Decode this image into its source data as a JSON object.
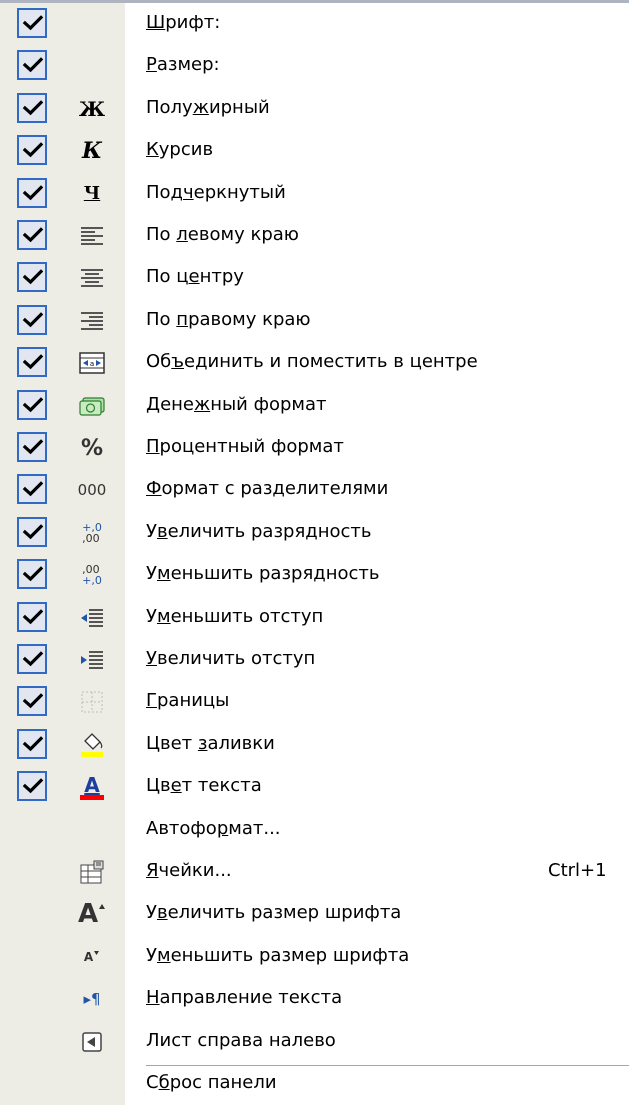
{
  "menu": {
    "items": [
      {
        "name": "font",
        "pre": "",
        "key": "Ш",
        "post": "рифт:",
        "checked": true,
        "icon": ""
      },
      {
        "name": "size",
        "pre": "",
        "key": "Р",
        "post": "азмер:",
        "checked": true,
        "icon": ""
      },
      {
        "name": "bold",
        "pre": "Полу",
        "key": "ж",
        "post": "ирный",
        "checked": true,
        "icon": "bold-icon"
      },
      {
        "name": "italic",
        "pre": "",
        "key": "К",
        "post": "урсив",
        "checked": true,
        "icon": "italic-icon"
      },
      {
        "name": "underline",
        "pre": "Под",
        "key": "ч",
        "post": "еркнутый",
        "checked": true,
        "icon": "underline-icon"
      },
      {
        "name": "align-left",
        "pre": "По ",
        "key": "л",
        "post": "евому краю",
        "checked": true,
        "icon": "align-left-icon"
      },
      {
        "name": "align-center",
        "pre": "По ц",
        "key": "е",
        "post": "нтру",
        "checked": true,
        "icon": "align-center-icon"
      },
      {
        "name": "align-right",
        "pre": "По ",
        "key": "п",
        "post": "равому краю",
        "checked": true,
        "icon": "align-right-icon"
      },
      {
        "name": "merge-center",
        "pre": "Об",
        "key": "ъ",
        "post": "единить и поместить в центре",
        "checked": true,
        "icon": "merge-center-icon"
      },
      {
        "name": "currency",
        "pre": "Дене",
        "key": "ж",
        "post": "ный формат",
        "checked": true,
        "icon": "currency-icon"
      },
      {
        "name": "percent",
        "pre": "",
        "key": "П",
        "post": "роцентный формат",
        "checked": true,
        "icon": "percent-icon"
      },
      {
        "name": "comma-style",
        "pre": "",
        "key": "Ф",
        "post": "ормат с разделителями",
        "checked": true,
        "icon": "comma-style-icon"
      },
      {
        "name": "increase-decimal",
        "pre": "У",
        "key": "в",
        "post": "еличить разрядность",
        "checked": true,
        "icon": "increase-decimal-icon"
      },
      {
        "name": "decrease-decimal",
        "pre": "У",
        "key": "м",
        "post": "еньшить разрядность",
        "checked": true,
        "icon": "decrease-decimal-icon"
      },
      {
        "name": "decrease-indent",
        "pre": "У",
        "key": "м",
        "post": "еньшить отступ",
        "checked": true,
        "icon": "decrease-indent-icon"
      },
      {
        "name": "increase-indent",
        "pre": "",
        "key": "У",
        "post": "величить отступ",
        "checked": true,
        "icon": "increase-indent-icon"
      },
      {
        "name": "borders",
        "pre": "",
        "key": "Г",
        "post": "раницы",
        "checked": true,
        "icon": "borders-icon"
      },
      {
        "name": "fill-color",
        "pre": "Цвет ",
        "key": "з",
        "post": "аливки",
        "checked": true,
        "icon": "fill-color-icon"
      },
      {
        "name": "font-color",
        "pre": "Цв",
        "key": "е",
        "post": "т текста",
        "checked": true,
        "icon": "font-color-icon"
      },
      {
        "name": "autoformat",
        "pre": "Автофо",
        "key": "р",
        "post": "мат...",
        "checked": false,
        "icon": ""
      },
      {
        "name": "format-cells",
        "pre": "",
        "key": "Я",
        "post": "чейки...",
        "checked": false,
        "icon": "format-cells-icon",
        "shortcut": "Ctrl+1"
      },
      {
        "name": "grow-font",
        "pre": "У",
        "key": "в",
        "post": "еличить размер шрифта",
        "checked": false,
        "icon": "grow-font-icon"
      },
      {
        "name": "shrink-font",
        "pre": "У",
        "key": "м",
        "post": "еньшить размер шрифта",
        "checked": false,
        "icon": "shrink-font-icon"
      },
      {
        "name": "text-direction",
        "pre": "",
        "key": "Н",
        "post": "аправление текста",
        "checked": false,
        "icon": "text-direction-icon"
      },
      {
        "name": "sheet-rtl",
        "pre": "Лист справа налево",
        "key": "",
        "post": "",
        "checked": false,
        "icon": "sheet-rtl-icon"
      },
      {
        "name": "reset-toolbar",
        "pre": "С",
        "key": "б",
        "post": "рос панели",
        "checked": false,
        "icon": ""
      }
    ],
    "glyphs": {
      "bold": "Ж",
      "italic": "К",
      "underline": "Ч",
      "percent": "%",
      "comma_style": "000",
      "inc_dec_top": "+,0",
      "inc_dec_bottom": ",00",
      "dec_dec_top": ",00",
      "dec_dec_bottom": "+,0",
      "font_color": "A",
      "grow_font": "A",
      "shrink_font": "A",
      "text_direction": "▸¶"
    },
    "colors": {
      "check_border": "#316ac5",
      "check_fill": "#e1e6f0",
      "fill_color_bar": "#ffff00",
      "font_color_bar": "#ff0000"
    }
  }
}
